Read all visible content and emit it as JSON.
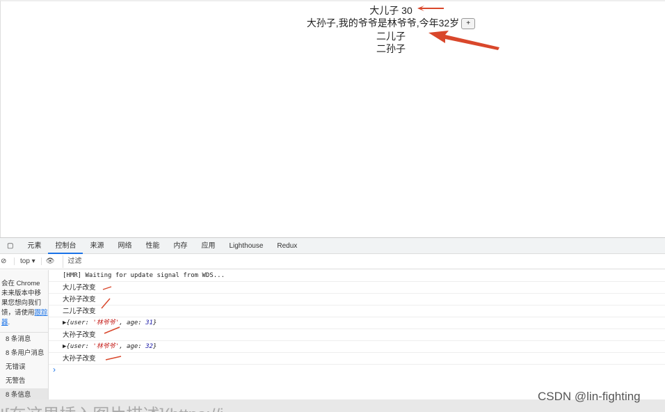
{
  "page": {
    "line1": "大儿子 30",
    "line2": "大孙子,我的爷爷是林爷爷,今年32岁",
    "plus_label": "+",
    "line3": "二儿子",
    "line4": "二孙子"
  },
  "devtools": {
    "tabs": [
      "元素",
      "控制台",
      "来源",
      "网络",
      "性能",
      "内存",
      "应用",
      "Lighthouse",
      "Redux"
    ],
    "active_tab": "控制台",
    "context": "top ▾",
    "filter_placeholder": "过滤",
    "sidebar": {
      "notice": "会在 Chrome 未来版本中移 果您想向我们 馈，请使用",
      "notice_link": "跟踪器",
      "items": [
        "8 条消息",
        "8 条用户消息",
        "无错误",
        "无警告",
        "8 条信息"
      ]
    },
    "console": {
      "hmr": "[HMR] Waiting for update signal from WDS...",
      "rows": [
        "大儿子改变",
        "大孙子改变",
        "二儿子改变"
      ],
      "obj1": {
        "prefix": "▶{user: ",
        "user": "'林爷爷'",
        "mid": ", age: ",
        "age": "31",
        "suffix": "}"
      },
      "row4": "大孙子改变",
      "obj2": {
        "prefix": "▶{user: ",
        "user": "'林爷爷'",
        "mid": ", age: ",
        "age": "32",
        "suffix": "}"
      },
      "row5": "大孙子改变",
      "prompt": "›"
    }
  },
  "bottom_text": "![在这里插入图片描述](https://i",
  "watermark": "CSDN @lin-fighting",
  "colors": {
    "arrow": "#d9472b",
    "accent": "#1a73e8"
  }
}
